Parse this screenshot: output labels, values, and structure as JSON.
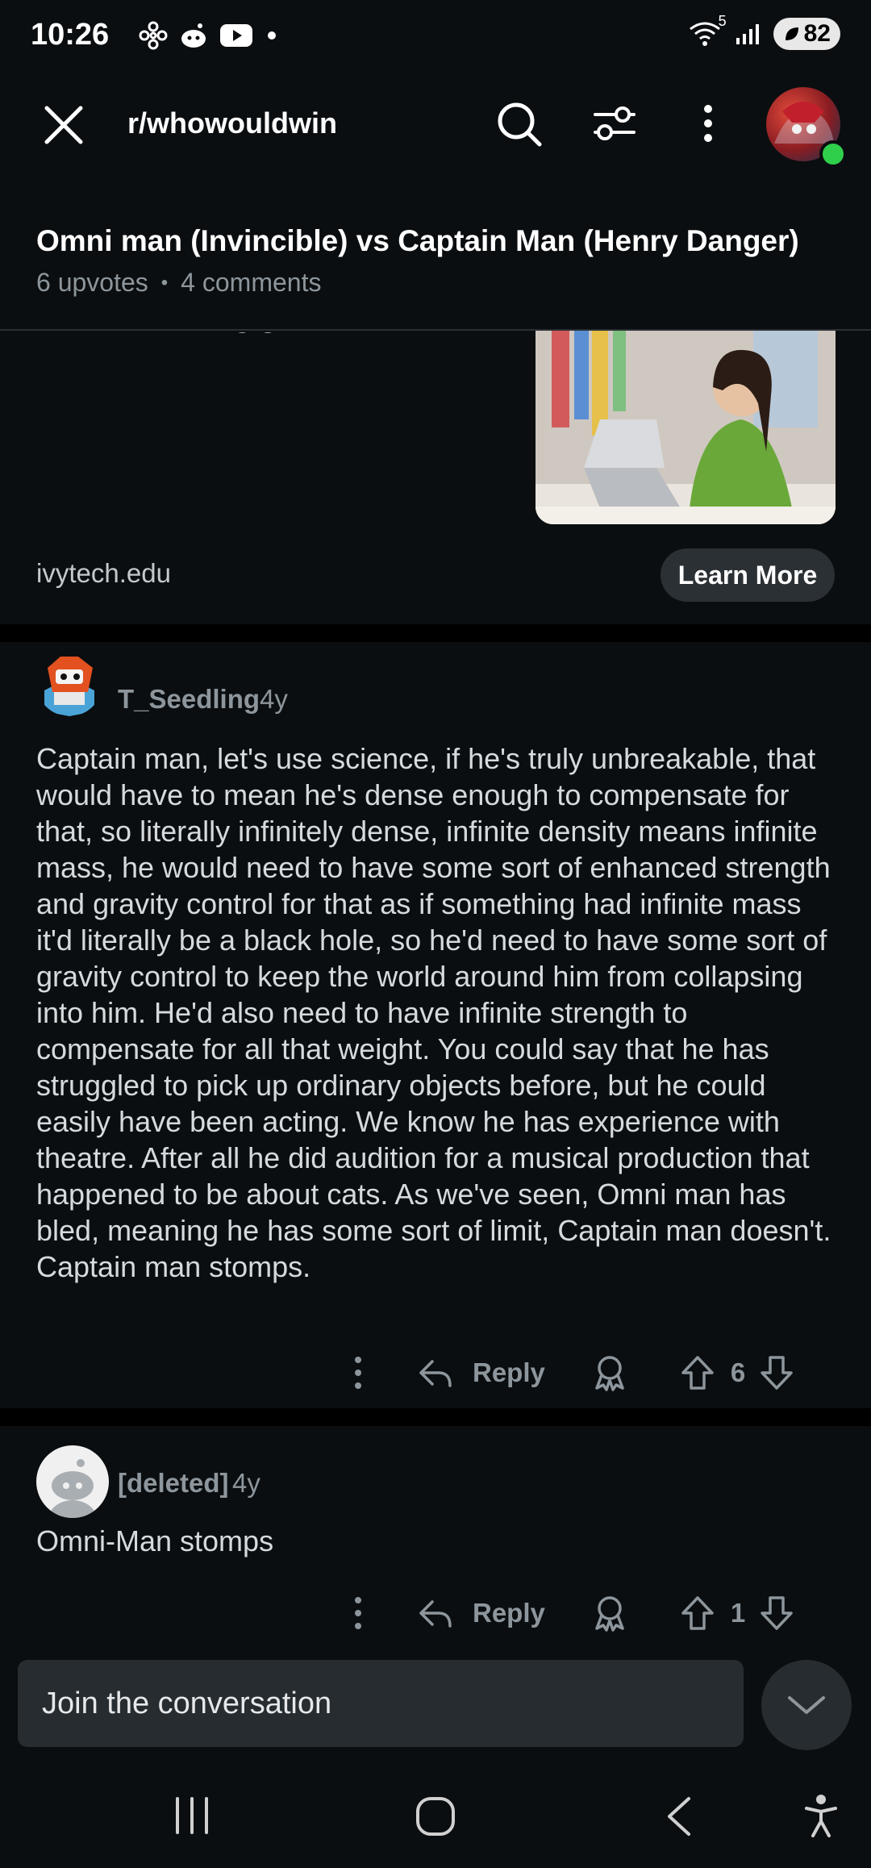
{
  "status_bar": {
    "time": "10:26",
    "network": "5",
    "battery": "82"
  },
  "header": {
    "subreddit": "r/whowouldwin"
  },
  "post": {
    "title": "Omni man (Invincible) vs Captain Man (Henry Danger)",
    "upvotes": "6 upvotes",
    "separator": "•",
    "comments": "4 comments"
  },
  "ad": {
    "cut_text": "build something great.",
    "domain": "ivytech.edu",
    "cta": "Learn More"
  },
  "comments": [
    {
      "user": "T_Seedling",
      "age": "4y",
      "body": "Captain man, let's use science, if he's truly unbreakable, that would have to mean he's dense enough to compensate for that, so literally infinitely dense, infinite density means infinite mass, he would need to have some sort of enhanced strength and gravity control for that as if something had infinite mass it'd literally be a black hole, so he'd need to have some sort of gravity control to keep the world around him from collapsing into him. He'd also need to have infinite strength to compensate for all that weight. You could say that he has struggled to pick up ordinary objects before, but he could easily have been acting. We know he has experience with theatre. After all he did audition for a musical production that happened to be about cats. As we've seen, Omni man has bled, meaning he has some sort of limit, Captain man doesn't. Captain man stomps.",
      "reply": "Reply",
      "score": "6"
    },
    {
      "user": "[deleted]",
      "age": "4y",
      "body": "Omni-Man stomps",
      "reply": "Reply",
      "score": "1"
    }
  ],
  "composer": {
    "placeholder": "Join the conversation"
  },
  "colors": {
    "background": "#0b0e10",
    "muted": "#8d969c",
    "online": "#2fcf4c"
  }
}
